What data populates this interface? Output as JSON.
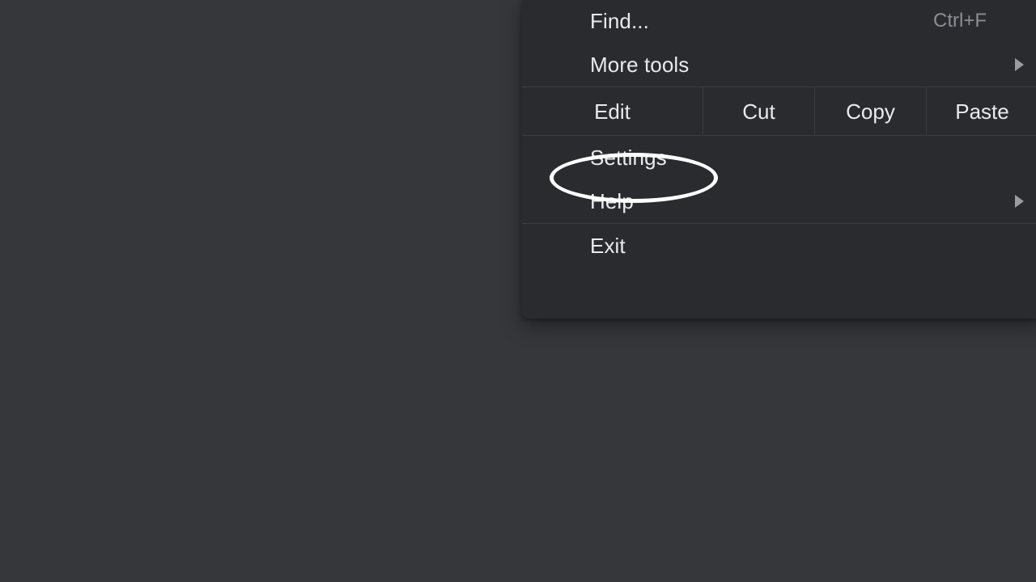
{
  "theme": {
    "desktop_background": "#36373b",
    "menu_background": "#2a2b2f",
    "menu_text": "#e9eaec",
    "shortcut_text": "#8b8e93",
    "separator": "#3a3c40",
    "highlight_stroke": "#ffffff",
    "arrow_color": "#9a9c9f"
  },
  "menu": {
    "items": [
      {
        "label": "Find...",
        "shortcut": "Ctrl+F",
        "has_submenu": false
      },
      {
        "label": "More tools",
        "shortcut": "",
        "has_submenu": true
      },
      {
        "label": "Settings",
        "shortcut": "",
        "has_submenu": false
      },
      {
        "label": "Help",
        "shortcut": "",
        "has_submenu": true
      },
      {
        "label": "Exit",
        "shortcut": "",
        "has_submenu": false
      }
    ],
    "edit_row": {
      "cells": [
        {
          "label": "Edit"
        },
        {
          "label": "Cut"
        },
        {
          "label": "Copy"
        },
        {
          "label": "Paste"
        }
      ]
    }
  },
  "annotation": {
    "type": "ellipse-highlight",
    "target_label": "Settings",
    "color": "#ffffff"
  }
}
